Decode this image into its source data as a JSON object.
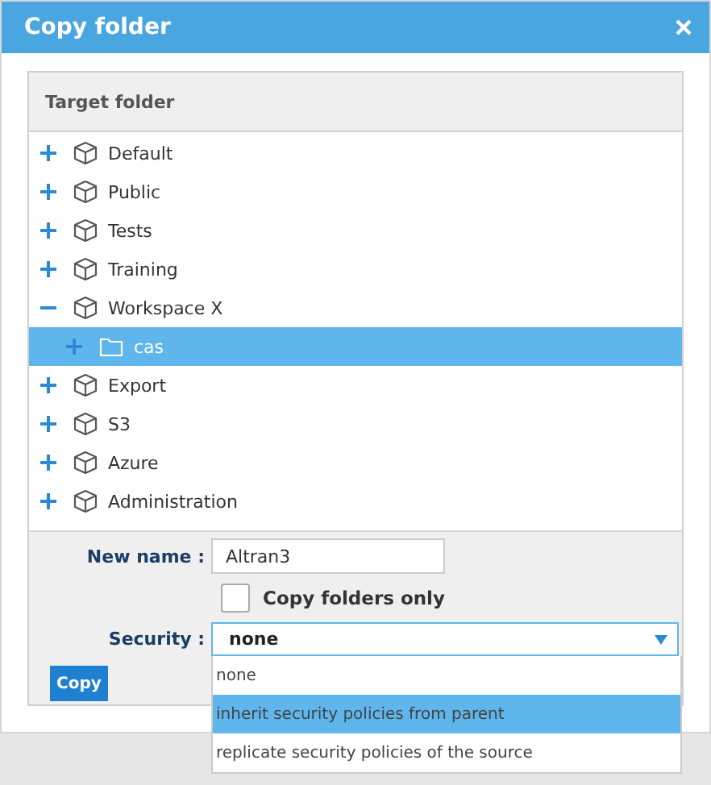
{
  "window": {
    "title": "Copy folder"
  },
  "panel": {
    "title": "Target folder"
  },
  "tree": [
    {
      "label": "Default",
      "kind": "workspace",
      "expanded": false,
      "selected": false
    },
    {
      "label": "Public",
      "kind": "workspace",
      "expanded": false,
      "selected": false
    },
    {
      "label": "Tests",
      "kind": "workspace",
      "expanded": false,
      "selected": false
    },
    {
      "label": "Training",
      "kind": "workspace",
      "expanded": false,
      "selected": false
    },
    {
      "label": "Workspace X",
      "kind": "workspace",
      "expanded": true,
      "selected": false,
      "children": [
        {
          "label": "cas",
          "kind": "folder",
          "expanded": false,
          "selected": true
        }
      ]
    },
    {
      "label": "Export",
      "kind": "workspace",
      "expanded": false,
      "selected": false
    },
    {
      "label": "S3",
      "kind": "workspace",
      "expanded": false,
      "selected": false
    },
    {
      "label": "Azure",
      "kind": "workspace",
      "expanded": false,
      "selected": false
    },
    {
      "label": "Administration",
      "kind": "workspace",
      "expanded": false,
      "selected": false
    }
  ],
  "form": {
    "new_name_label": "New name :",
    "new_name_value": "Altran3",
    "copy_folders_only": {
      "label": "Copy folders only",
      "checked": false
    },
    "security_label": "Security :",
    "security_value": "none",
    "security_options": [
      {
        "label": "none",
        "selected": false
      },
      {
        "label": "inherit security policies from parent",
        "selected": true
      },
      {
        "label": "replicate security policies of the source",
        "selected": false
      }
    ],
    "copy_button": "Copy"
  }
}
